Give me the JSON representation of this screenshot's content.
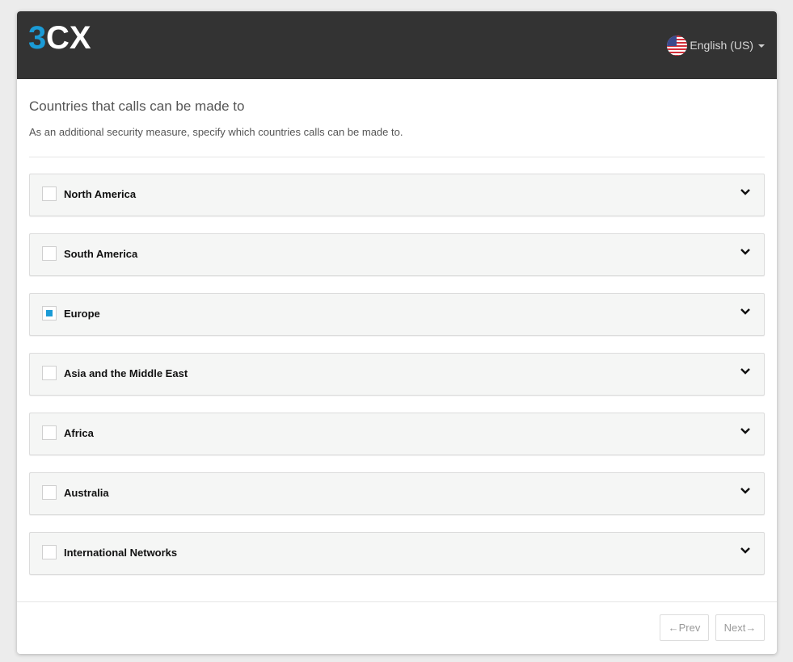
{
  "header": {
    "logo_text": "3CX",
    "language": "English (US)",
    "language_icon": "us-flag-icon"
  },
  "page": {
    "title": "Countries that calls can be made to",
    "subtitle": "As an additional security measure, specify which countries calls can be made to."
  },
  "regions": [
    {
      "label": "North America",
      "state": "unchecked"
    },
    {
      "label": "South America",
      "state": "unchecked"
    },
    {
      "label": "Europe",
      "state": "partial"
    },
    {
      "label": "Asia and the Middle East",
      "state": "unchecked"
    },
    {
      "label": "Africa",
      "state": "unchecked"
    },
    {
      "label": "Australia",
      "state": "unchecked"
    },
    {
      "label": "International Networks",
      "state": "unchecked"
    }
  ],
  "footer": {
    "prev_label": "←Prev",
    "next_label": "Next→"
  },
  "colors": {
    "header_bg": "#333333",
    "accent": "#1b9bd6",
    "region_bg": "#f5f6f5"
  }
}
